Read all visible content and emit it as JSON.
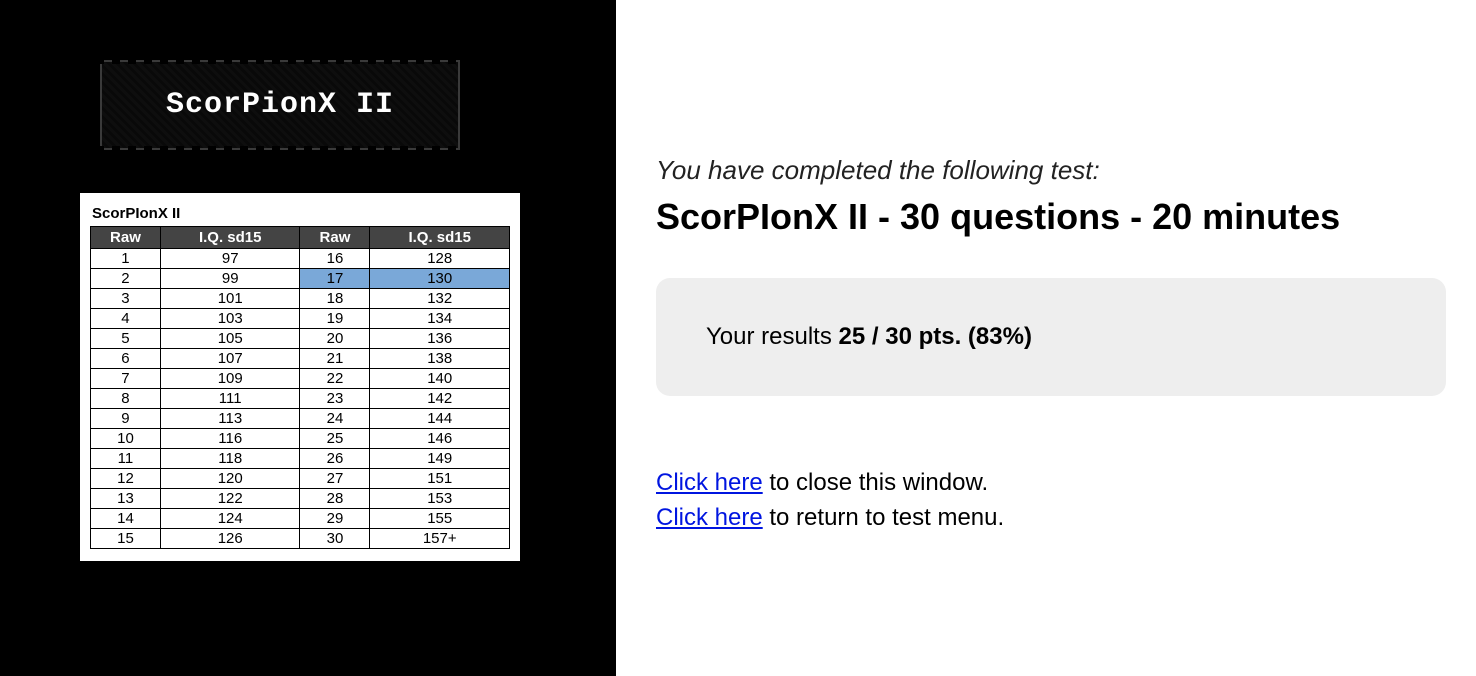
{
  "banner": {
    "title": "ScorPionX II"
  },
  "score_table": {
    "title": "ScorPIonX II",
    "headers": [
      "Raw",
      "I.Q. sd15",
      "Raw",
      "I.Q. sd15"
    ],
    "highlight_raw": 17,
    "rows": [
      {
        "r1": 1,
        "iq1": "97",
        "r2": 16,
        "iq2": "128"
      },
      {
        "r1": 2,
        "iq1": "99",
        "r2": 17,
        "iq2": "130"
      },
      {
        "r1": 3,
        "iq1": "101",
        "r2": 18,
        "iq2": "132"
      },
      {
        "r1": 4,
        "iq1": "103",
        "r2": 19,
        "iq2": "134"
      },
      {
        "r1": 5,
        "iq1": "105",
        "r2": 20,
        "iq2": "136"
      },
      {
        "r1": 6,
        "iq1": "107",
        "r2": 21,
        "iq2": "138"
      },
      {
        "r1": 7,
        "iq1": "109",
        "r2": 22,
        "iq2": "140"
      },
      {
        "r1": 8,
        "iq1": "111",
        "r2": 23,
        "iq2": "142"
      },
      {
        "r1": 9,
        "iq1": "113",
        "r2": 24,
        "iq2": "144"
      },
      {
        "r1": 10,
        "iq1": "116",
        "r2": 25,
        "iq2": "146"
      },
      {
        "r1": 11,
        "iq1": "118",
        "r2": 26,
        "iq2": "149"
      },
      {
        "r1": 12,
        "iq1": "120",
        "r2": 27,
        "iq2": "151"
      },
      {
        "r1": 13,
        "iq1": "122",
        "r2": 28,
        "iq2": "153"
      },
      {
        "r1": 14,
        "iq1": "124",
        "r2": 29,
        "iq2": "155"
      },
      {
        "r1": 15,
        "iq1": "126",
        "r2": 30,
        "iq2": "157+"
      }
    ]
  },
  "results": {
    "completed_text": "You have completed the following test:",
    "test_name": "ScorPIonX II - 30 questions - 20 minutes",
    "result_label": "Your results ",
    "result_value": "25 / 30 pts. (83%)",
    "close_link": "Click here",
    "close_tail": " to close this window.",
    "menu_link": "Click here",
    "menu_tail": " to return to test menu."
  }
}
